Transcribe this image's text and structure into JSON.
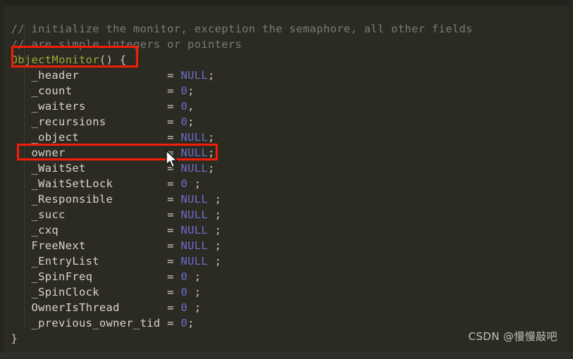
{
  "editor": {
    "background_color": "#2b2b24",
    "comment_color": "#7b7b70",
    "identifier_color": "#d9d4c6",
    "value_color": "#6c6cc8",
    "function_color": "#9aa832",
    "annotation_color": "#f41d08",
    "comments": [
      "// initialize the monitor, exception the semaphore, all other fields",
      "// are simple integers or pointers"
    ],
    "constructor": {
      "name": "ObjectMonitor",
      "parens": "()",
      "open_brace": "{"
    },
    "close_brace": "}",
    "indent": "   ",
    "fields": [
      {
        "name": "_header",
        "pad": "             ",
        "op": "=",
        "value": "NULL",
        "terminator": ";"
      },
      {
        "name": "_count",
        "pad": "              ",
        "op": "=",
        "value": "0",
        "terminator": ";"
      },
      {
        "name": "_waiters",
        "pad": "            ",
        "op": "=",
        "value": "0",
        "terminator": ","
      },
      {
        "name": "_recursions",
        "pad": "         ",
        "op": "=",
        "value": "0",
        "terminator": ";"
      },
      {
        "name": "_object",
        "pad": "             ",
        "op": "=",
        "value": "NULL",
        "terminator": ";"
      },
      {
        "name": "owner",
        "pad": "               ",
        "op": "=",
        "value": "NULL",
        "terminator": ";"
      },
      {
        "name": "_WaitSet",
        "pad": "            ",
        "op": "=",
        "value": "NULL",
        "terminator": ";"
      },
      {
        "name": "_WaitSetLock",
        "pad": "        ",
        "op": "=",
        "value": "0",
        "terminator": " ;"
      },
      {
        "name": "_Responsible",
        "pad": "        ",
        "op": "=",
        "value": "NULL",
        "terminator": " ;"
      },
      {
        "name": "_succ",
        "pad": "               ",
        "op": "=",
        "value": "NULL",
        "terminator": " ;"
      },
      {
        "name": "_cxq",
        "pad": "                ",
        "op": "=",
        "value": "NULL",
        "terminator": " ;"
      },
      {
        "name": "FreeNext",
        "pad": "            ",
        "op": "=",
        "value": "NULL",
        "terminator": " ;"
      },
      {
        "name": "_EntryList",
        "pad": "          ",
        "op": "=",
        "value": "NULL",
        "terminator": " ;"
      },
      {
        "name": "_SpinFreq",
        "pad": "           ",
        "op": "=",
        "value": "0",
        "terminator": " ;"
      },
      {
        "name": "_SpinClock",
        "pad": "          ",
        "op": "=",
        "value": "0",
        "terminator": " ;"
      },
      {
        "name": "OwnerIsThread",
        "pad": "       ",
        "op": "=",
        "value": "0",
        "terminator": " ;"
      },
      {
        "name": "_previous_owner_tid",
        "pad": " ",
        "op": "=",
        "value": "0",
        "terminator": ";"
      }
    ]
  },
  "annotations": [
    {
      "id": "redbox-ctor",
      "target": "ObjectMonitor()"
    },
    {
      "id": "redbox-owner",
      "target": "owner = NULL;"
    }
  ],
  "watermark": {
    "text": "CSDN @慢慢敲吧"
  }
}
